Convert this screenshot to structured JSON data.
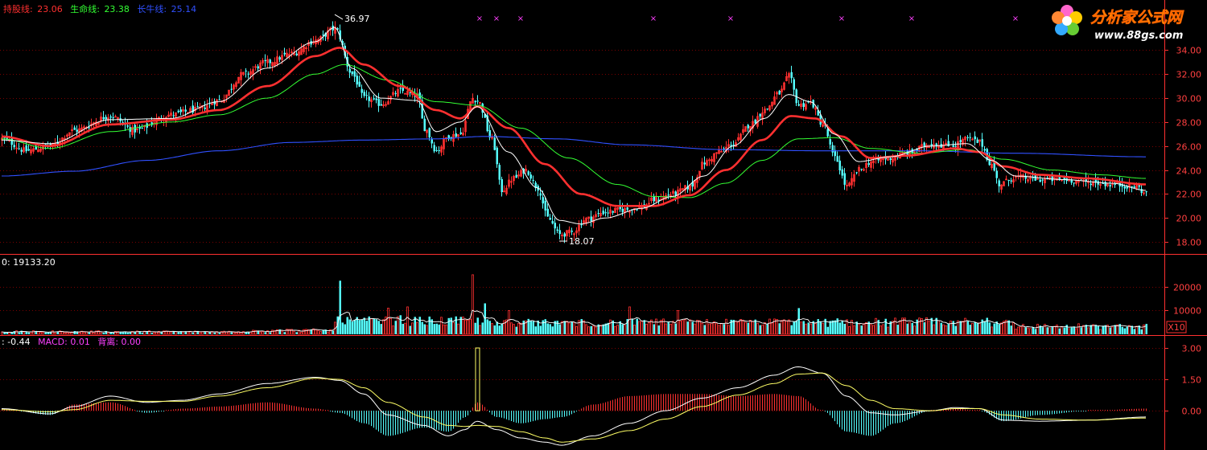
{
  "indicators": {
    "hold_line": {
      "label": "持股线:",
      "value": "23.06",
      "color": "#ff3030"
    },
    "life_line": {
      "label": "生命线:",
      "value": "23.38",
      "color": "#33ff33"
    },
    "long_line": {
      "label": "长牛线:",
      "value": "25.14",
      "color": "#3050ff"
    }
  },
  "volume_panel": {
    "label": "0: 19133.20"
  },
  "macd_panel": {
    "items": [
      {
        "label": ": -0.44",
        "color": "#ffffff"
      },
      {
        "label": "MACD: 0.01",
        "color": "#ff40ff"
      },
      {
        "label": "背离: 0.00",
        "color": "#ff40ff"
      }
    ]
  },
  "logo": {
    "name": "分析家公式网",
    "url": "www.88gs.com"
  },
  "colors": {
    "up": "#ff3030",
    "down": "#55ffff",
    "grid": "#7a0000",
    "axis": "#ff3030"
  },
  "chart_data": [
    {
      "type": "candlestick",
      "name": "price",
      "ylim": [
        17,
        35.5
      ],
      "yticks": [
        "18.00",
        "20.00",
        "22.00",
        "24.00",
        "26.00",
        "28.00",
        "30.00",
        "32.00",
        "34.00"
      ],
      "annotations": [
        {
          "text": "36.97",
          "x": 138,
          "y": 36.97
        },
        {
          "text": "18.07",
          "x": 231,
          "y": 18.07
        }
      ],
      "markers_x": [
        198,
        205,
        215,
        270,
        302,
        348,
        377,
        420
      ],
      "anchors_close": [
        [
          0,
          26.6
        ],
        [
          10,
          25.6
        ],
        [
          20,
          26.0
        ],
        [
          30,
          27.3
        ],
        [
          45,
          28.5
        ],
        [
          55,
          27.3
        ],
        [
          70,
          28.6
        ],
        [
          80,
          29.0
        ],
        [
          90,
          29.8
        ],
        [
          100,
          32.0
        ],
        [
          110,
          33.0
        ],
        [
          120,
          33.7
        ],
        [
          130,
          34.8
        ],
        [
          138,
          35.8
        ],
        [
          145,
          32.0
        ],
        [
          150,
          30.0
        ],
        [
          157,
          29.5
        ],
        [
          165,
          30.6
        ],
        [
          172,
          30.2
        ],
        [
          175,
          27.5
        ],
        [
          180,
          25.6
        ],
        [
          185,
          26.8
        ],
        [
          190,
          27.0
        ],
        [
          195,
          30.0
        ],
        [
          197,
          29.8
        ],
        [
          203,
          26.5
        ],
        [
          207,
          22.3
        ],
        [
          212,
          23.3
        ],
        [
          217,
          24.0
        ],
        [
          222,
          22.5
        ],
        [
          226,
          20.0
        ],
        [
          231,
          18.6
        ],
        [
          236,
          18.8
        ],
        [
          242,
          19.9
        ],
        [
          250,
          20.5
        ],
        [
          258,
          20.7
        ],
        [
          265,
          20.9
        ],
        [
          270,
          21.5
        ],
        [
          278,
          22.0
        ],
        [
          285,
          22.6
        ],
        [
          291,
          24.6
        ],
        [
          297,
          25.5
        ],
        [
          303,
          26.2
        ],
        [
          310,
          27.8
        ],
        [
          316,
          29.0
        ],
        [
          322,
          30.4
        ],
        [
          326,
          31.8
        ],
        [
          330,
          29.4
        ],
        [
          335,
          29.6
        ],
        [
          340,
          27.8
        ],
        [
          345,
          25.0
        ],
        [
          350,
          22.6
        ],
        [
          355,
          24.0
        ],
        [
          360,
          24.7
        ],
        [
          368,
          25.0
        ],
        [
          375,
          25.4
        ],
        [
          385,
          26.2
        ],
        [
          393,
          26.0
        ],
        [
          400,
          26.6
        ],
        [
          405,
          26.3
        ],
        [
          410,
          24.4
        ],
        [
          413,
          22.8
        ],
        [
          420,
          23.4
        ],
        [
          430,
          23.2
        ],
        [
          440,
          23.2
        ],
        [
          450,
          23.0
        ],
        [
          460,
          22.8
        ],
        [
          470,
          22.6
        ],
        [
          474,
          22.0
        ]
      ],
      "anchors_ma5": [
        [
          0,
          26.5
        ],
        [
          20,
          26.2
        ],
        [
          45,
          28.2
        ],
        [
          70,
          28.3
        ],
        [
          90,
          29.7
        ],
        [
          110,
          32.5
        ],
        [
          130,
          34.7
        ],
        [
          138,
          35.9
        ],
        [
          145,
          32.5
        ],
        [
          157,
          30.0
        ],
        [
          172,
          29.8
        ],
        [
          180,
          27.2
        ],
        [
          190,
          28.0
        ],
        [
          197,
          29.3
        ],
        [
          210,
          25.5
        ],
        [
          222,
          22.5
        ],
        [
          231,
          19.8
        ],
        [
          240,
          19.5
        ],
        [
          250,
          20.0
        ],
        [
          265,
          20.8
        ],
        [
          278,
          21.8
        ],
        [
          291,
          23.5
        ],
        [
          303,
          26.0
        ],
        [
          316,
          28.3
        ],
        [
          326,
          30.3
        ],
        [
          335,
          29.7
        ],
        [
          345,
          27.0
        ],
        [
          355,
          24.7
        ],
        [
          368,
          25.1
        ],
        [
          385,
          26.0
        ],
        [
          400,
          26.2
        ],
        [
          410,
          24.8
        ],
        [
          420,
          23.5
        ],
        [
          440,
          23.2
        ],
        [
          460,
          22.9
        ],
        [
          474,
          22.3
        ]
      ],
      "anchors_ma10": [
        [
          0,
          26.8
        ],
        [
          20,
          26.0
        ],
        [
          45,
          27.8
        ],
        [
          70,
          28.2
        ],
        [
          90,
          29.0
        ],
        [
          110,
          31.0
        ],
        [
          130,
          33.5
        ],
        [
          140,
          34.2
        ],
        [
          150,
          32.8
        ],
        [
          165,
          31.0
        ],
        [
          180,
          29.0
        ],
        [
          190,
          28.3
        ],
        [
          197,
          29.3
        ],
        [
          210,
          27.5
        ],
        [
          225,
          24.5
        ],
        [
          240,
          22.0
        ],
        [
          255,
          21.0
        ],
        [
          270,
          21.0
        ],
        [
          285,
          21.9
        ],
        [
          300,
          24.0
        ],
        [
          315,
          26.5
        ],
        [
          327,
          28.5
        ],
        [
          337,
          28.3
        ],
        [
          348,
          26.8
        ],
        [
          360,
          25.0
        ],
        [
          375,
          25.2
        ],
        [
          395,
          25.8
        ],
        [
          405,
          25.5
        ],
        [
          415,
          24.3
        ],
        [
          430,
          23.6
        ],
        [
          450,
          23.3
        ],
        [
          474,
          22.8
        ]
      ],
      "anchors_ma20": [
        [
          0,
          26.6
        ],
        [
          20,
          25.8
        ],
        [
          45,
          27.2
        ],
        [
          70,
          28.0
        ],
        [
          90,
          28.6
        ],
        [
          110,
          30.0
        ],
        [
          130,
          32.0
        ],
        [
          142,
          32.8
        ],
        [
          160,
          31.5
        ],
        [
          180,
          29.7
        ],
        [
          197,
          29.4
        ],
        [
          215,
          27.5
        ],
        [
          235,
          25.0
        ],
        [
          255,
          22.8
        ],
        [
          270,
          21.8
        ],
        [
          285,
          21.7
        ],
        [
          300,
          22.9
        ],
        [
          315,
          24.8
        ],
        [
          330,
          26.6
        ],
        [
          345,
          26.7
        ],
        [
          360,
          25.8
        ],
        [
          380,
          25.4
        ],
        [
          400,
          25.7
        ],
        [
          415,
          24.9
        ],
        [
          435,
          24.0
        ],
        [
          455,
          23.6
        ],
        [
          474,
          23.3
        ]
      ],
      "anchors_ma60": [
        [
          0,
          23.5
        ],
        [
          30,
          23.9
        ],
        [
          60,
          24.8
        ],
        [
          90,
          25.6
        ],
        [
          120,
          26.3
        ],
        [
          150,
          26.5
        ],
        [
          180,
          26.6
        ],
        [
          200,
          26.8
        ],
        [
          230,
          26.6
        ],
        [
          260,
          26.1
        ],
        [
          300,
          25.7
        ],
        [
          340,
          25.6
        ],
        [
          380,
          25.6
        ],
        [
          420,
          25.4
        ],
        [
          474,
          25.1
        ]
      ]
    },
    {
      "type": "bar",
      "name": "volume",
      "ylim": [
        0,
        27000
      ],
      "yticks": [
        "10000",
        "20000"
      ],
      "unit_tag": "X10",
      "big_volumes": [
        [
          140,
          22500
        ],
        [
          195,
          25000
        ],
        [
          160,
          11000
        ],
        [
          165,
          8000
        ],
        [
          168,
          11500
        ],
        [
          200,
          13000
        ],
        [
          210,
          10000
        ],
        [
          260,
          11500
        ],
        [
          280,
          10000
        ],
        [
          330,
          11000
        ]
      ]
    },
    {
      "type": "macd",
      "name": "macd",
      "ylim": [
        -1.8,
        3.5
      ],
      "yticks": [
        "3.00",
        "1.50",
        "0.00"
      ],
      "anchors_dif": [
        [
          0,
          0.1
        ],
        [
          20,
          -0.15
        ],
        [
          30,
          0.2
        ],
        [
          45,
          0.7
        ],
        [
          60,
          0.4
        ],
        [
          75,
          0.5
        ],
        [
          90,
          0.8
        ],
        [
          110,
          1.3
        ],
        [
          130,
          1.6
        ],
        [
          140,
          1.45
        ],
        [
          150,
          0.8
        ],
        [
          160,
          -0.2
        ],
        [
          175,
          -0.7
        ],
        [
          185,
          -1.2
        ],
        [
          192,
          -0.9
        ],
        [
          197,
          -0.5
        ],
        [
          205,
          -0.9
        ],
        [
          215,
          -1.3
        ],
        [
          225,
          -1.5
        ],
        [
          232,
          -1.65
        ],
        [
          245,
          -1.2
        ],
        [
          260,
          -0.6
        ],
        [
          275,
          0.0
        ],
        [
          290,
          0.6
        ],
        [
          305,
          1.1
        ],
        [
          320,
          1.7
        ],
        [
          330,
          2.1
        ],
        [
          340,
          1.8
        ],
        [
          350,
          0.7
        ],
        [
          360,
          -0.1
        ],
        [
          370,
          -0.2
        ],
        [
          385,
          0.0
        ],
        [
          395,
          0.15
        ],
        [
          405,
          0.1
        ],
        [
          415,
          -0.45
        ],
        [
          430,
          -0.5
        ],
        [
          450,
          -0.45
        ],
        [
          474,
          -0.3
        ]
      ],
      "anchors_dea": [
        [
          0,
          0.05
        ],
        [
          20,
          -0.05
        ],
        [
          30,
          0.05
        ],
        [
          45,
          0.5
        ],
        [
          60,
          0.45
        ],
        [
          75,
          0.45
        ],
        [
          90,
          0.7
        ],
        [
          110,
          1.1
        ],
        [
          130,
          1.55
        ],
        [
          140,
          1.5
        ],
        [
          150,
          1.1
        ],
        [
          160,
          0.4
        ],
        [
          175,
          -0.3
        ],
        [
          185,
          -0.7
        ],
        [
          192,
          -0.75
        ],
        [
          197,
          -0.7
        ],
        [
          205,
          -0.75
        ],
        [
          215,
          -1.0
        ],
        [
          225,
          -1.3
        ],
        [
          232,
          -1.5
        ],
        [
          245,
          -1.35
        ],
        [
          260,
          -0.95
        ],
        [
          275,
          -0.4
        ],
        [
          290,
          0.2
        ],
        [
          305,
          0.75
        ],
        [
          320,
          1.3
        ],
        [
          330,
          1.75
        ],
        [
          340,
          1.8
        ],
        [
          350,
          1.2
        ],
        [
          360,
          0.5
        ],
        [
          370,
          0.1
        ],
        [
          385,
          0.0
        ],
        [
          395,
          0.1
        ],
        [
          405,
          0.1
        ],
        [
          415,
          -0.2
        ],
        [
          430,
          -0.4
        ],
        [
          450,
          -0.45
        ],
        [
          474,
          -0.35
        ]
      ],
      "spikes": [
        [
          197,
          3.0
        ]
      ]
    }
  ]
}
